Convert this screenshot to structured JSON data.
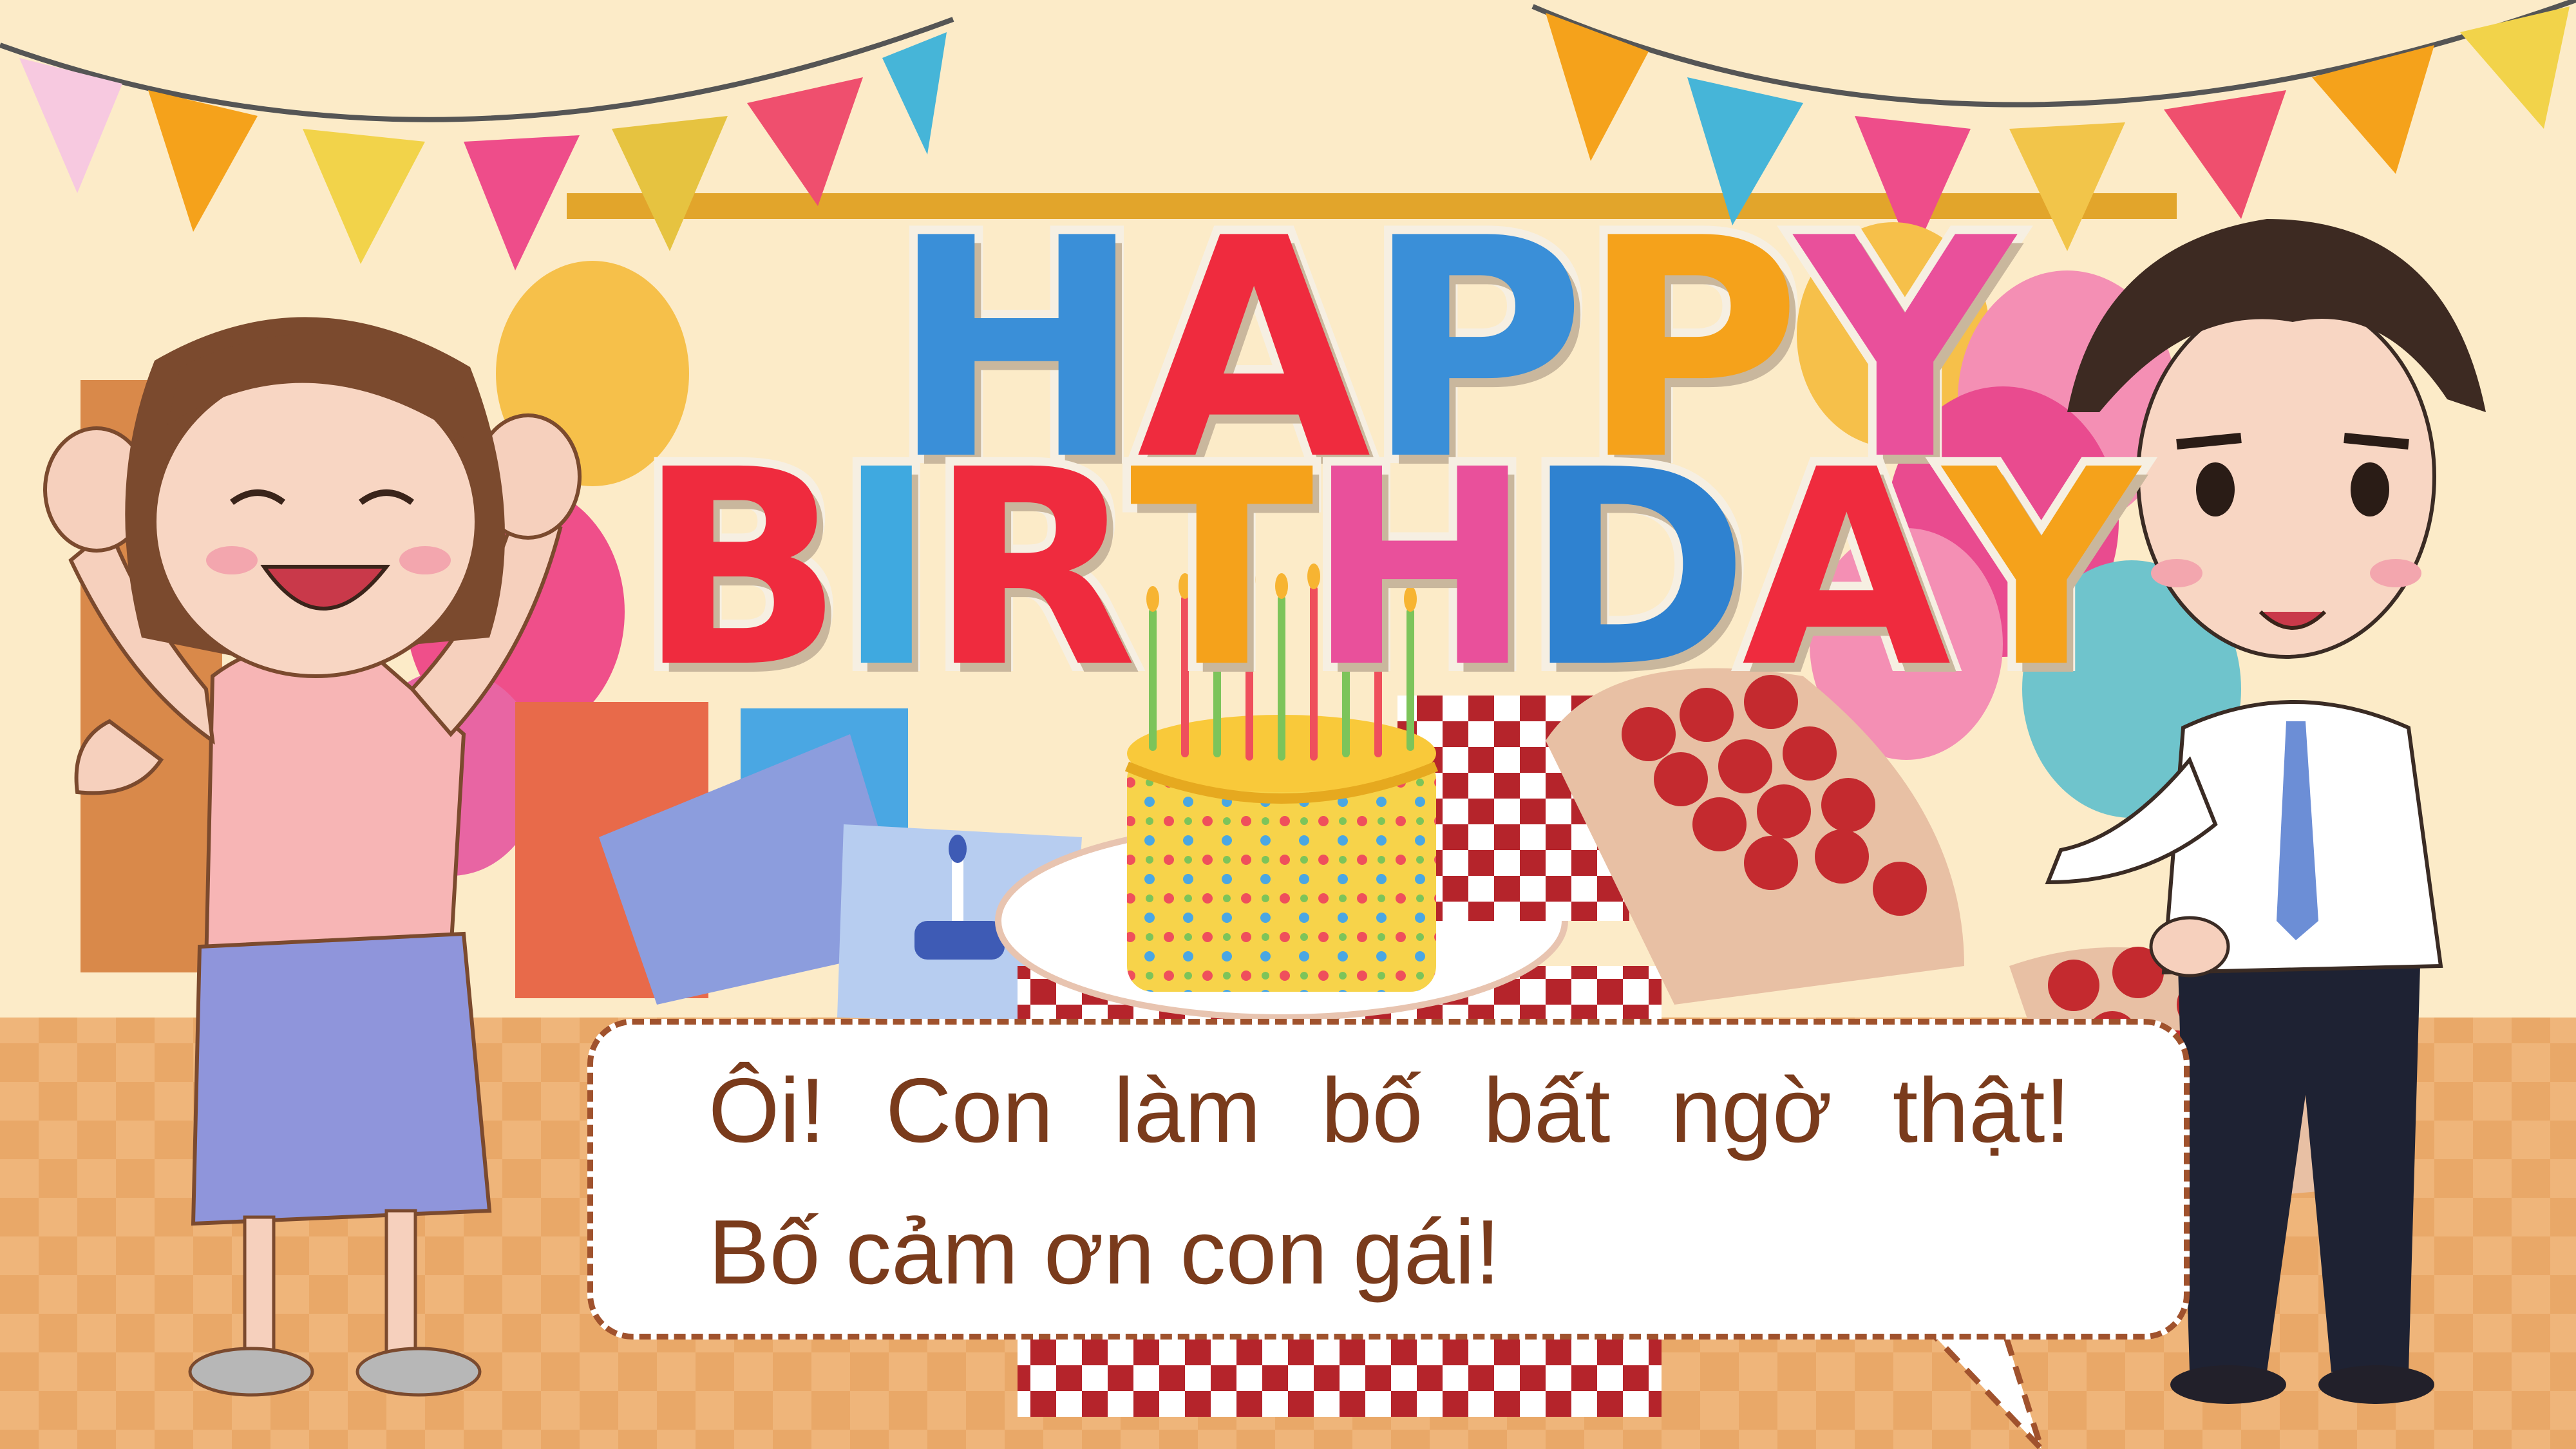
{
  "sign": {
    "line1": [
      "H",
      "A",
      "P",
      "P",
      "Y"
    ],
    "line2": [
      "B",
      "I",
      "R",
      "T",
      "H",
      "D",
      "A",
      "Y"
    ],
    "line1_colors": [
      "#3a8fd8",
      "#ef2b3e",
      "#3a8fd8",
      "#f5a21b",
      "#e9509b"
    ],
    "line2_colors": [
      "#ef2b3e",
      "#3fa9e0",
      "#ef2b3e",
      "#f5a21b",
      "#e9509b",
      "#2f82d0",
      "#ef2b3e",
      "#f5a21b"
    ]
  },
  "dialogue": {
    "line1": "Ôi! Con làm bố bất ngờ thật!",
    "line2": "Bố cảm ơn con gái!"
  },
  "colors": {
    "background": "#fbe7c0",
    "bubble_border": "#a0522d",
    "bubble_text": "#7a3b1c"
  }
}
